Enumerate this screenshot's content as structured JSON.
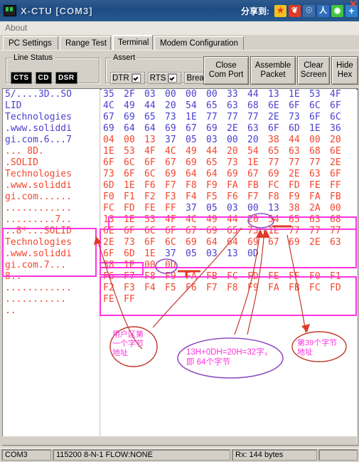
{
  "window": {
    "title": "X-CTU    [COM3]",
    "app_icon": "terminal-icon",
    "close_label": "✕"
  },
  "share": {
    "label": "分享到:",
    "icons": [
      {
        "name": "sina-weibo-share-icon",
        "glyph": "★"
      },
      {
        "name": "weibo-share-icon",
        "glyph": "❦"
      },
      {
        "name": "qzone-share-icon",
        "glyph": "☉"
      },
      {
        "name": "renren-share-icon",
        "glyph": "人"
      },
      {
        "name": "wechat-share-icon",
        "glyph": "◉"
      },
      {
        "name": "more-share-icon",
        "glyph": "+"
      }
    ]
  },
  "menu": {
    "items": [
      "About"
    ]
  },
  "tabs": [
    {
      "label": "PC Settings",
      "active": false
    },
    {
      "label": "Range Test",
      "active": false
    },
    {
      "label": "Terminal",
      "active": true
    },
    {
      "label": "Modem Configuration",
      "active": false
    }
  ],
  "line_status": {
    "title": "Line Status",
    "leds": [
      "CTS",
      "CD",
      "DSR"
    ]
  },
  "assert": {
    "title": "Assert",
    "checks": [
      {
        "label": "DTR",
        "checked": true
      },
      {
        "label": "RTS",
        "checked": true
      },
      {
        "label": "Break",
        "checked": false
      }
    ]
  },
  "buttons": [
    {
      "name": "close-com-port-button",
      "line1": "Close",
      "line2": "Com Port"
    },
    {
      "name": "assemble-packet-button",
      "line1": "Assemble",
      "line2": "Packet"
    },
    {
      "name": "clear-screen-button",
      "line1": "Clear",
      "line2": "Screen"
    },
    {
      "name": "hide-hex-button",
      "line1": "Hide",
      "line2": "Hex"
    }
  ],
  "terminal": {
    "ascii_lines": [
      {
        "text": "5/....3D..SO",
        "color": "blue"
      },
      {
        "text": "LID",
        "color": "blue"
      },
      {
        "text": "Technologies",
        "color": "blue"
      },
      {
        "text": ".www.soliddi",
        "color": "blue"
      },
      {
        "text": "gi.com.6...7",
        "color": "blue"
      },
      {
        "text": "... 8D.",
        "color": "red"
      },
      {
        "text": ".SOLID",
        "color": "red"
      },
      {
        "text": "Technologies",
        "color": "red"
      },
      {
        "text": ".www.soliddi",
        "color": "red"
      },
      {
        "text": "gi.com......",
        "color": "red"
      },
      {
        "text": "............",
        "color": "red"
      },
      {
        "text": ".........7..",
        "color": "red"
      },
      {
        "text": "..8*...SOLID",
        "color": "red"
      },
      {
        "text": "Technologies",
        "color": "red"
      },
      {
        "text": ".www.soliddi",
        "color": "red"
      },
      {
        "text": "gi.com.7...",
        "color": "red"
      },
      {
        "text": "8..",
        "color": "red"
      },
      {
        "text": "............",
        "color": "red"
      },
      {
        "text": "...........",
        "color": "red"
      },
      {
        "text": "..",
        "color": "red"
      }
    ],
    "hex_rows": [
      {
        "bytes": [
          "35",
          "2F",
          "03",
          "00",
          "00",
          "00",
          "33",
          "44",
          "13",
          "1E",
          "53",
          "4F"
        ],
        "color": "blue"
      },
      {
        "bytes": [
          "4C",
          "49",
          "44",
          "20",
          "54",
          "65",
          "63",
          "68",
          "6E",
          "6F",
          "6C",
          "6F"
        ],
        "color": "blue"
      },
      {
        "bytes": [
          "67",
          "69",
          "65",
          "73",
          "1E",
          "77",
          "77",
          "77",
          "2E",
          "73",
          "6F",
          "6C"
        ],
        "color": "blue"
      },
      {
        "bytes": [
          "69",
          "64",
          "64",
          "69",
          "67",
          "69",
          "2E",
          "63",
          "6F",
          "6D",
          "1E",
          "36"
        ],
        "color": "blue"
      },
      {
        "bytes": [
          "04",
          "00",
          "13",
          "37",
          "05",
          "03",
          "00",
          "20",
          "38",
          "44",
          "00",
          "20"
        ],
        "color": "mixed_1"
      },
      {
        "bytes": [
          "1E",
          "53",
          "4F",
          "4C",
          "49",
          "44",
          "20",
          "54",
          "65",
          "63",
          "68",
          "6E"
        ],
        "color": "red"
      },
      {
        "bytes": [
          "6F",
          "6C",
          "6F",
          "67",
          "69",
          "65",
          "73",
          "1E",
          "77",
          "77",
          "77",
          "2E"
        ],
        "color": "red"
      },
      {
        "bytes": [
          "73",
          "6F",
          "6C",
          "69",
          "64",
          "64",
          "69",
          "67",
          "69",
          "2E",
          "63",
          "6F"
        ],
        "color": "red"
      },
      {
        "bytes": [
          "6D",
          "1E",
          "F6",
          "F7",
          "F8",
          "F9",
          "FA",
          "FB",
          "FC",
          "FD",
          "FE",
          "FF"
        ],
        "color": "red"
      },
      {
        "bytes": [
          "F0",
          "F1",
          "F2",
          "F3",
          "F4",
          "F5",
          "F6",
          "F7",
          "F8",
          "F9",
          "FA",
          "FB"
        ],
        "color": "red"
      },
      {
        "bytes": [
          "FC",
          "FD",
          "FE",
          "FF",
          "37",
          "05",
          "03",
          "00",
          "13",
          "38",
          "2A",
          "00"
        ],
        "color": "mixed_2"
      },
      {
        "bytes": [
          "13",
          "1E",
          "53",
          "4F",
          "4C",
          "49",
          "44",
          "20",
          "54",
          "65",
          "63",
          "68"
        ],
        "color": "red"
      },
      {
        "bytes": [
          "6E",
          "6F",
          "6C",
          "6F",
          "67",
          "69",
          "65",
          "73",
          "1E",
          "77",
          "77",
          "77"
        ],
        "color": "red"
      },
      {
        "bytes": [
          "2E",
          "73",
          "6F",
          "6C",
          "69",
          "64",
          "64",
          "69",
          "67",
          "69",
          "2E",
          "63"
        ],
        "color": "red"
      },
      {
        "bytes": [
          "6F",
          "6D",
          "1E",
          "37",
          "05",
          "03",
          "13",
          "0D"
        ],
        "color": "mixed_3"
      },
      {
        "bytes": [
          "38",
          "1E",
          "00",
          "0D"
        ],
        "color": "red"
      },
      {
        "bytes": [
          "F6",
          "F7",
          "F8",
          "F9",
          "FA",
          "FB",
          "FC",
          "FD",
          "FE",
          "FF",
          "F0",
          "F1"
        ],
        "color": "red"
      },
      {
        "bytes": [
          "F2",
          "F3",
          "F4",
          "F5",
          "F6",
          "F7",
          "F8",
          "F9",
          "FA",
          "FB",
          "FC",
          "FD"
        ],
        "color": "red"
      },
      {
        "bytes": [
          "FE",
          "FF"
        ],
        "color": "red"
      }
    ]
  },
  "annotations": {
    "note_left": "用户区第\n一个字节\n地址",
    "note_center_line1": "13H+0DH=20H=32字，",
    "note_center_line2": "即 64个字节",
    "note_right": "第39个字节\n地址",
    "circled_bytes": [
      "00",
      "13"
    ],
    "highlight_color": "#ff33dd",
    "arrow_color": "#e03a28",
    "note_outline_left": "#e03a28",
    "note_outline_center": "#a040d0"
  },
  "statusbar": {
    "port": "COM3",
    "settings": "115200 8-N-1  FLOW:NONE",
    "rx": "Rx: 144 bytes",
    "extra": ""
  }
}
